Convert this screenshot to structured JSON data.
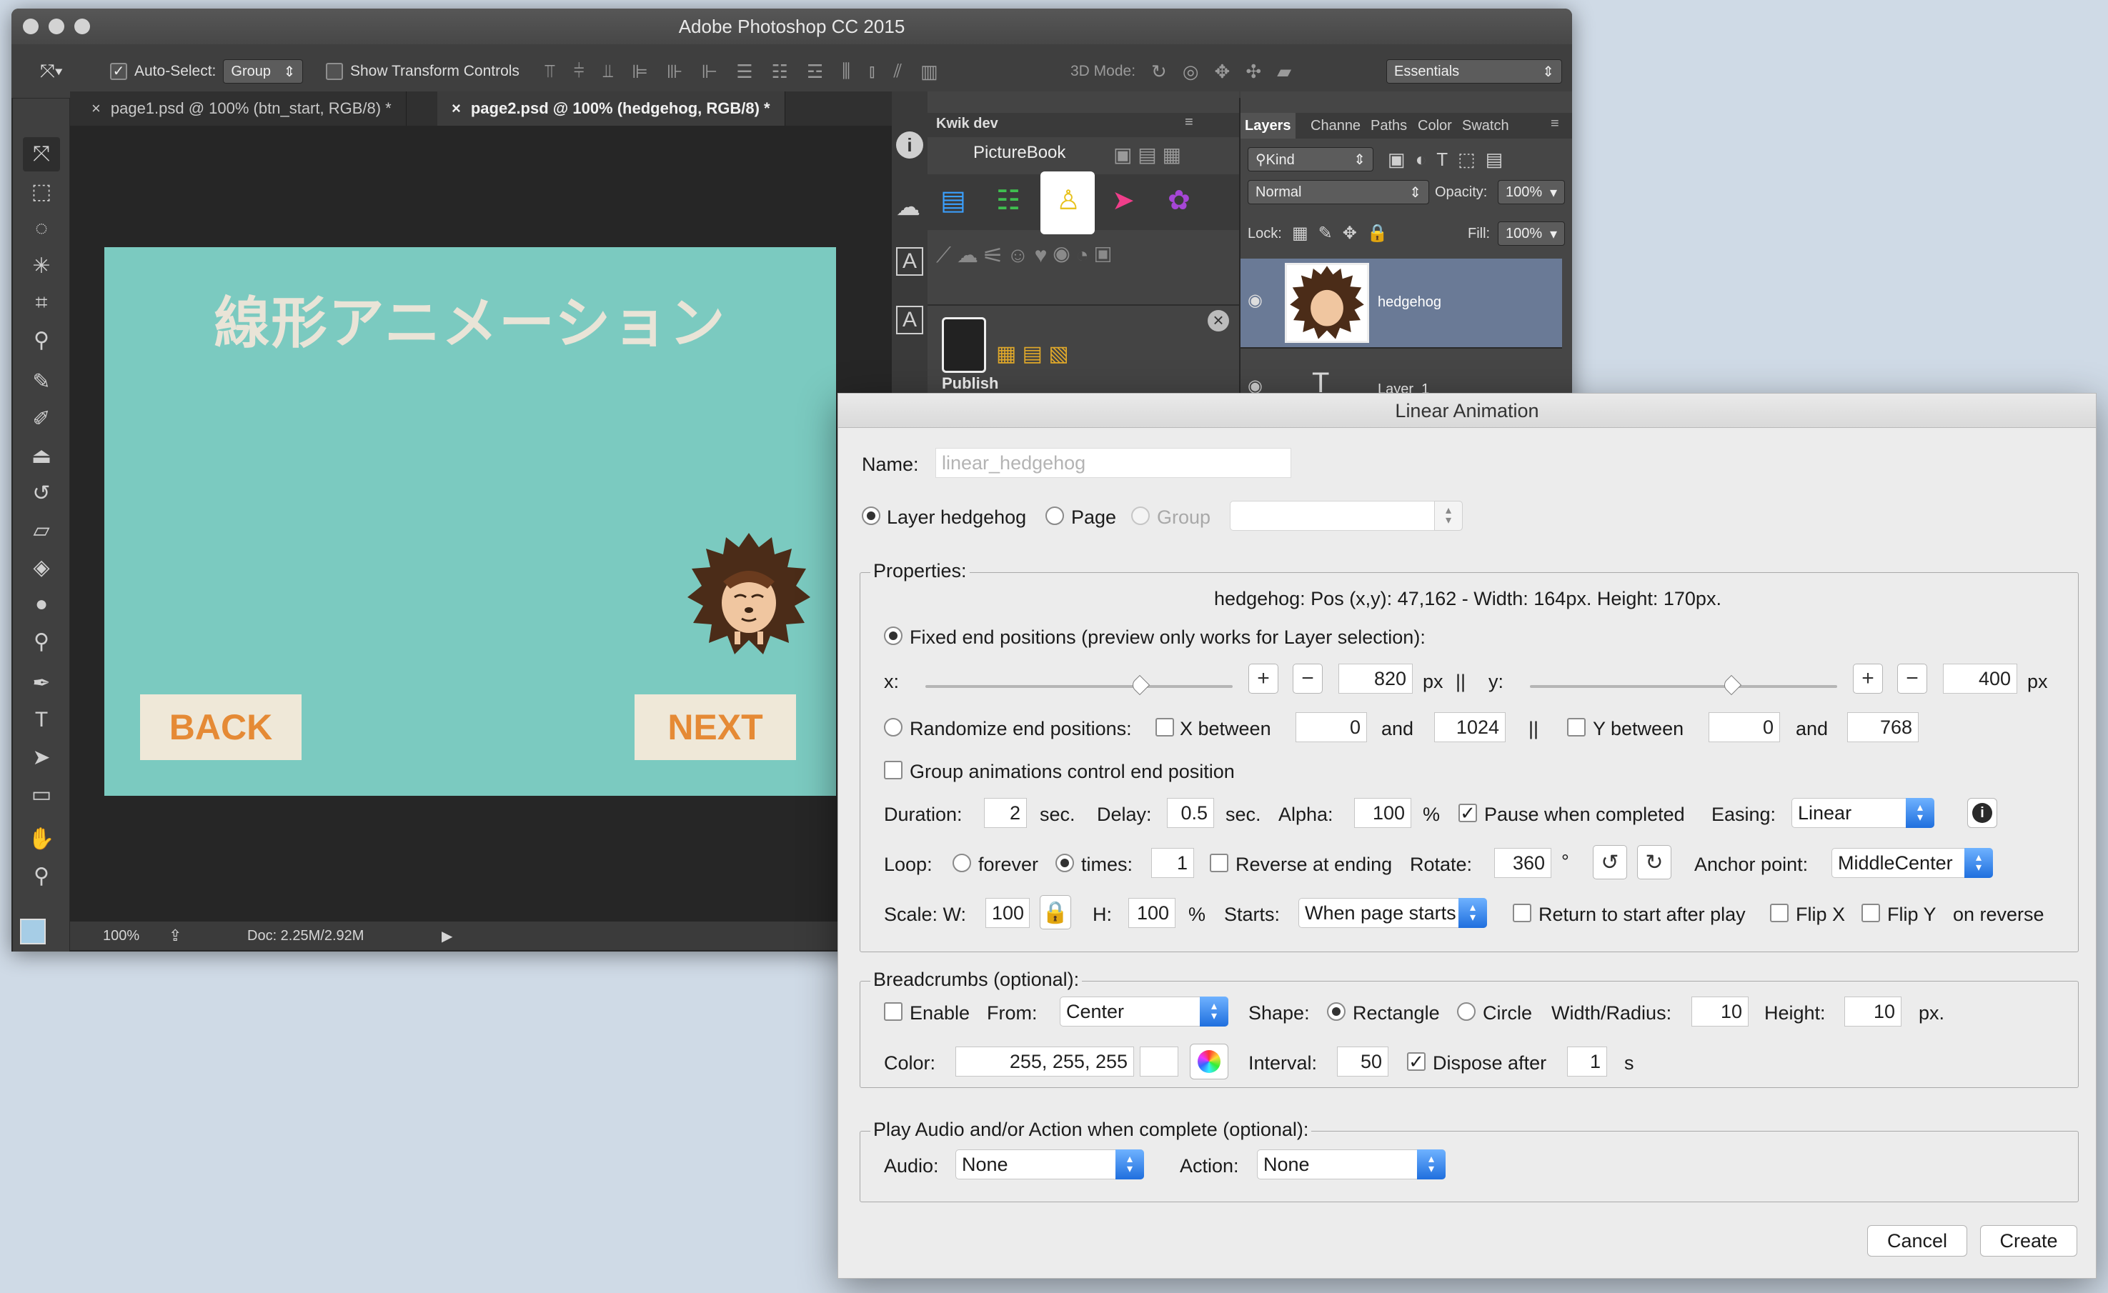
{
  "photoshop": {
    "title": "Adobe Photoshop CC 2015",
    "options": {
      "auto_select_label": "Auto-Select:",
      "auto_select_checked": true,
      "auto_select_value": "Group",
      "show_transform_label": "Show Transform Controls",
      "mode_3d_label": "3D Mode:",
      "workspace": "Essentials"
    },
    "doc_tabs": [
      {
        "label": "page1.psd @ 100% (btn_start, RGB/8) *",
        "active": false
      },
      {
        "label": "page2.psd @ 100% (hedgehog, RGB/8) *",
        "active": true
      }
    ],
    "artboard": {
      "title": "線形アニメーション",
      "back_label": "BACK",
      "next_label": "NEXT",
      "bg_color": "#7bcac0"
    },
    "status": {
      "zoom": "100%",
      "doc": "Doc: 2.25M/2.92M"
    },
    "kwik": {
      "tab": "Kwik dev",
      "product": "PictureBook",
      "publish_label": "Publish"
    },
    "layers_panel": {
      "tabs": [
        "Layers",
        "Channe",
        "Paths",
        "Color",
        "Swatch"
      ],
      "filter": "Kind",
      "blend": "Normal",
      "opacity_label": "Opacity:",
      "opacity": "100%",
      "lock_label": "Lock:",
      "fill_label": "Fill:",
      "fill": "100%",
      "layers": [
        {
          "name": "hedgehog",
          "selected": true,
          "type": "image"
        },
        {
          "name": "Layer_1",
          "selected": false,
          "type": "text"
        }
      ]
    }
  },
  "dialog": {
    "title": "Linear Animation",
    "name_label": "Name:",
    "name_value": "linear_hedgehog",
    "target": {
      "layer_label": "Layer hedgehog",
      "page_label": "Page",
      "group_label": "Group",
      "selected": "layer"
    },
    "properties": {
      "title": "Properties:",
      "info": "hedgehog: Pos (x,y): 47,162 - Width: 164px. Height: 170px.",
      "fixed_label": "Fixed end positions (preview only works for Layer selection):",
      "x_label": "x:",
      "x_value": "820",
      "x_unit": "px",
      "sep": "||",
      "y_label": "y:",
      "y_value": "400",
      "y_unit": "px",
      "random_label": "Randomize end positions:",
      "x_between_label": "X between",
      "x_min": "0",
      "and_label": "and",
      "x_max": "1024",
      "y_between_label": "Y between",
      "y_min": "0",
      "y_max": "768",
      "group_ctrl_label": "Group animations control end position",
      "duration_label": "Duration:",
      "duration": "2",
      "sec_label": "sec.",
      "delay_label": "Delay:",
      "delay": "0.5",
      "alpha_label": "Alpha:",
      "alpha": "100",
      "pct": "%",
      "pause_label": "Pause when completed",
      "pause_checked": true,
      "easing_label": "Easing:",
      "easing": "Linear",
      "loop_label": "Loop:",
      "forever_label": "forever",
      "times_label": "times:",
      "times": "1",
      "reverse_label": "Reverse at ending",
      "rotate_label": "Rotate:",
      "rotate": "360",
      "degree": "°",
      "anchor_label": "Anchor point:",
      "anchor": "MiddleCenter",
      "scale_w_label": "Scale: W:",
      "scale_w": "100",
      "h_label": "H:",
      "scale_h": "100",
      "starts_label": "Starts:",
      "starts": "When page starts",
      "return_label": "Return to start after play",
      "flipx_label": "Flip X",
      "flipy_label": "Flip Y",
      "on_reverse_label": "on reverse"
    },
    "breadcrumbs": {
      "title": "Breadcrumbs (optional):",
      "enable_label": "Enable",
      "from_label": "From:",
      "from": "Center",
      "shape_label": "Shape:",
      "rect_label": "Rectangle",
      "circle_label": "Circle",
      "wr_label": "Width/Radius:",
      "wr": "10",
      "height_label": "Height:",
      "height": "10",
      "px_label": "px.",
      "color_label": "Color:",
      "color": "255, 255, 255",
      "interval_label": "Interval:",
      "interval": "50",
      "dispose_label": "Dispose after",
      "dispose_checked": true,
      "dispose": "1",
      "s_label": "s"
    },
    "audio": {
      "title": "Play Audio and/or Action when complete (optional):",
      "audio_label": "Audio:",
      "audio": "None",
      "action_label": "Action:",
      "action": "None"
    },
    "cancel_label": "Cancel",
    "create_label": "Create"
  }
}
